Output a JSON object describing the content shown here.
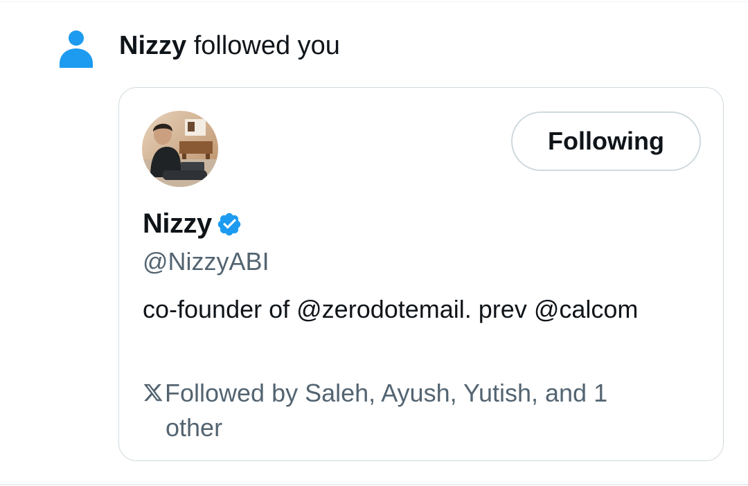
{
  "notification": {
    "icon": "person-icon",
    "actor_name": "Nizzy",
    "action_text": " followed you",
    "accent_color": "#1d9bf0"
  },
  "profile_card": {
    "avatar": "user-avatar",
    "follow_button_label": "Following",
    "display_name": "Nizzy",
    "verified_icon": "verified-badge-icon",
    "handle": "@NizzyABI",
    "bio": "co-founder of @zerodotemail. prev @calcom",
    "followed_by_icon": "x-logo-icon",
    "followed_by_line1": "Followed by Saleh, Ayush, Yutish, and 1",
    "followed_by_line2": "other"
  }
}
